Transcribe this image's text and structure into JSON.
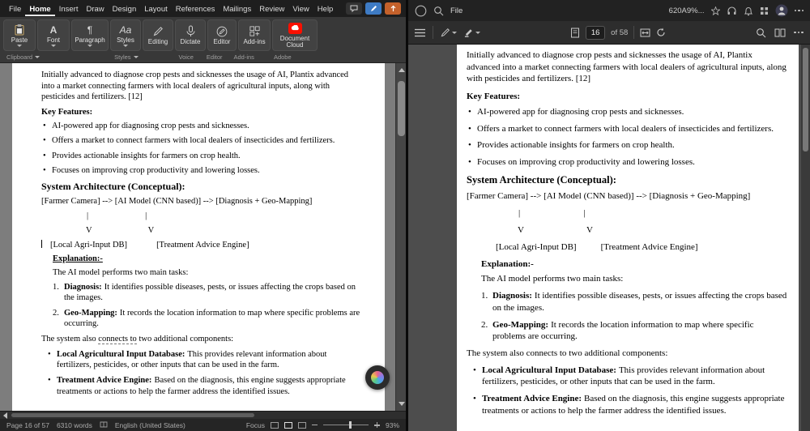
{
  "word": {
    "menu_items": [
      "File",
      "Home",
      "Insert",
      "Draw",
      "Design",
      "Layout",
      "References",
      "Mailings",
      "Review",
      "View",
      "Help"
    ],
    "ribbon_buttons": [
      "Paste",
      "Font",
      "Paragraph",
      "Styles",
      "Editing",
      "Dictate",
      "Editor",
      "Add-ins",
      "Document Cloud"
    ],
    "ribbon_groups": [
      "Clipboard",
      "Styles",
      "Voice",
      "Editor",
      "Add-ins",
      "Adobe"
    ],
    "status": {
      "page": "Page 16 of 57",
      "words": "6310 words",
      "language": "English (United States)",
      "focus": "Focus",
      "zoom": "93%"
    }
  },
  "pdf": {
    "file_menu": "File",
    "title": "620A9%...",
    "page_value": "16",
    "page_total": "of 58"
  },
  "doc": {
    "bullet_char": "•",
    "intro": "Initially advanced to diagnose crop pests and sicknesses the usage of AI, Plantix advanced into a market connecting farmers with local dealers of agricultural inputs, along with pesticides and fertilizers. [12]",
    "key_features_heading": "Key Features:",
    "features": [
      "AI-powered app for diagnosing crop pests and sicknesses.",
      "Offers a market to connect farmers with local dealers of insecticides and fertilizers.",
      "Provides actionable insights for farmers on crop health.",
      "Focuses on improving crop productivity and lowering losses."
    ],
    "arch_heading": "System Architecture (Conceptual):",
    "arch": {
      "flow": "[Farmer Camera] --> [AI Model (CNN based)] --> [Diagnosis + Geo-Mapping]",
      "pipe": "|",
      "v": "V",
      "left_box": "[Local Agri-Input DB]",
      "right_box": "[Treatment Advice Engine]"
    },
    "explanation_heading": "Explanation:-",
    "tasks_intro": "The AI model performs two main tasks:",
    "tasks": [
      {
        "num": "1.",
        "bold": "Diagnosis:",
        "text": "It identifies possible diseases, pests, or issues affecting the crops based on the images."
      },
      {
        "num": "2.",
        "bold": "Geo-Mapping:",
        "text": "It records the location information to map where specific problems are occurring."
      }
    ],
    "connects": {
      "pre": "The system also ",
      "mid": "connects to",
      "post": " two additional components:"
    },
    "components": [
      {
        "bold": "Local Agricultural Input Database:",
        "text": "This provides relevant information about fertilizers, pesticides, or other inputs that can be used in the farm."
      },
      {
        "bold": "Treatment Advice Engine:",
        "text": "Based on the diagnosis, this engine suggests appropriate treatments or actions to help the farmer address the identified issues."
      }
    ]
  }
}
